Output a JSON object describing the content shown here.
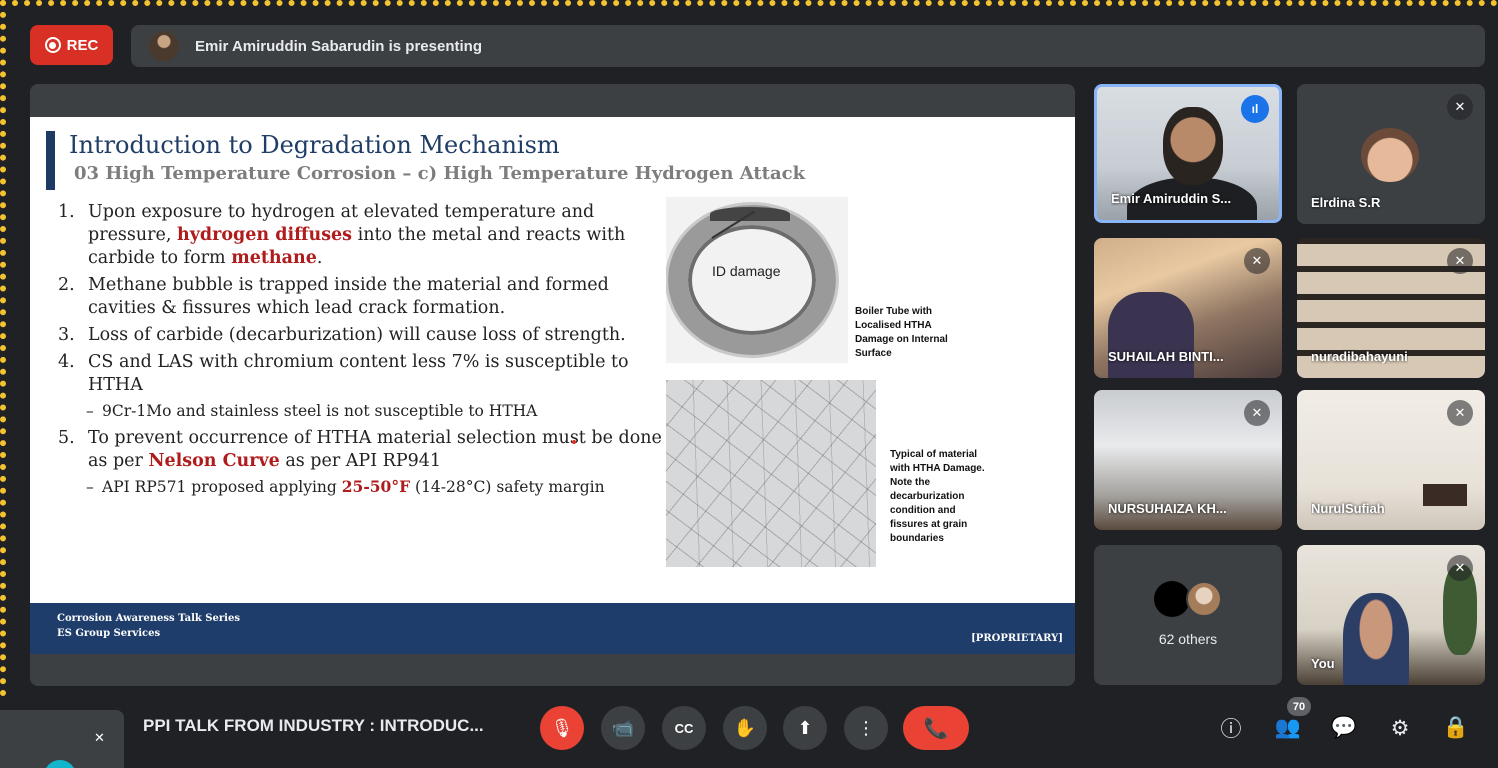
{
  "top": {
    "rec_label": "REC",
    "presenting_text": "Emir Amiruddin Sabarudin is presenting"
  },
  "slide": {
    "title": "Introduction to Degradation Mechanism",
    "subtitle": "03 High Temperature Corrosion – c) High Temperature Hydrogen Attack",
    "items": [
      {
        "num": "1.",
        "parts": [
          "Upon exposure to hydrogen at elevated temperature and pressure, ",
          "hydrogen diffuses",
          " into the metal and reacts with carbide to form ",
          "methane",
          "."
        ]
      },
      {
        "num": "2.",
        "text": "Methane bubble is trapped inside the material and formed cavities & fissures which lead crack formation."
      },
      {
        "num": "3.",
        "text": "Loss of carbide (decarburization) will cause loss of strength."
      },
      {
        "num": "4.",
        "text": "CS and LAS with chromium content less 7% is susceptible to HTHA",
        "sub": "9Cr-1Mo and stainless steel is not susceptible to HTHA"
      },
      {
        "num": "5.",
        "parts": [
          "To prevent occurrence of HTHA material selection must be done as per ",
          "Nelson Curve",
          " as per API RP941"
        ],
        "sub_parts": [
          "API RP571 proposed applying ",
          "25-50°F",
          " (14-28°C) safety margin"
        ]
      }
    ],
    "image1_label": "ID damage",
    "caption1": "Boiler Tube with Localised HTHA Damage on Internal Surface",
    "caption2": "Typical of material with HTHA Damage. Note the decarburization condition and fissures at grain boundaries",
    "footer_line1": "Corrosion Awareness Talk Series",
    "footer_line2": "ES Group Services",
    "footer_right": "[PROPRIETARY]"
  },
  "participants": [
    {
      "name": "Emir Amiruddin S...",
      "state": "speaking"
    },
    {
      "name": "Elrdina S.R",
      "state": "muted"
    },
    {
      "name": "SUHAILAH BINTI...",
      "state": "muted"
    },
    {
      "name": "nuradibahayuni",
      "state": "muted"
    },
    {
      "name": "NURSUHAIZA KH...",
      "state": "muted"
    },
    {
      "name": "NurulSufiah",
      "state": "muted"
    },
    {
      "name": "62 others",
      "state": "group"
    },
    {
      "name": "You",
      "state": "muted"
    }
  ],
  "bottom": {
    "meeting_title": "PPI TALK FROM INDUSTRY : INTRODUC...",
    "people_count": "70"
  },
  "icons": {
    "mic_off": "🎙",
    "camera": "📹",
    "captions": "CC",
    "raise_hand": "✋",
    "present": "⬆",
    "more": "⋮",
    "end_call": "📞",
    "info": "ⓘ",
    "people": "👥",
    "chat": "💬",
    "activities": "⚙",
    "host_controls": "🔒"
  },
  "colors": {
    "accent_blue": "#8ab4f8",
    "rec_red": "#d93025",
    "highlight_red": "#b01c1c",
    "slide_navy": "#1e3d6b"
  }
}
